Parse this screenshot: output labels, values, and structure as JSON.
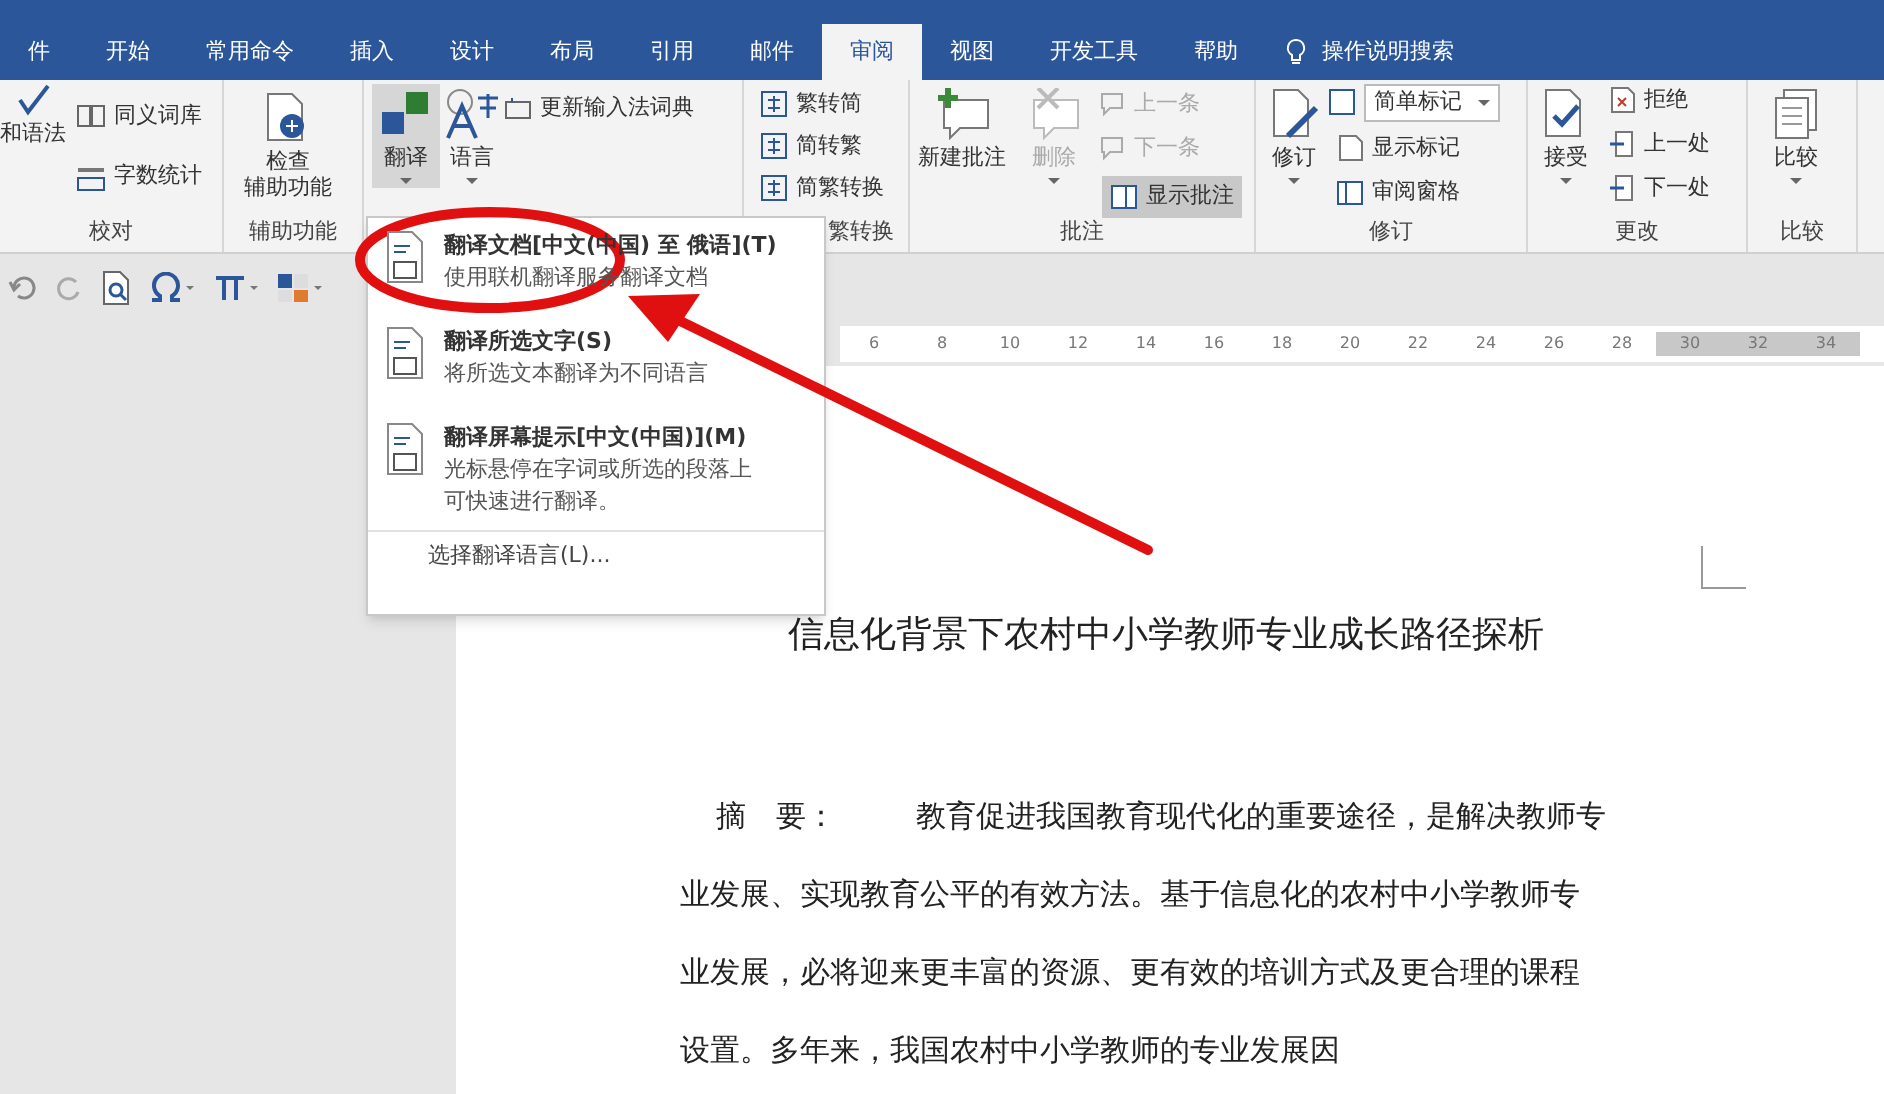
{
  "tabs": [
    {
      "label": "件",
      "selected": false
    },
    {
      "label": "开始",
      "selected": false
    },
    {
      "label": "常用命令",
      "selected": false
    },
    {
      "label": "插入",
      "selected": false
    },
    {
      "label": "设计",
      "selected": false
    },
    {
      "label": "布局",
      "selected": false
    },
    {
      "label": "引用",
      "selected": false
    },
    {
      "label": "邮件",
      "selected": false
    },
    {
      "label": "审阅",
      "selected": true
    },
    {
      "label": "视图",
      "selected": false
    },
    {
      "label": "开发工具",
      "selected": false
    },
    {
      "label": "帮助",
      "selected": false
    }
  ],
  "tell_me": "操作说明搜索",
  "ribbon": {
    "proofing": {
      "spelling": "和语法",
      "thesaurus": "同义词库",
      "word_count": "字数统计",
      "label": "校对"
    },
    "accessibility": {
      "check": [
        "检查",
        "辅助功能"
      ],
      "label": "辅助功能"
    },
    "language": {
      "translate": "翻译",
      "language": "语言",
      "update_ime": "更新输入法词典"
    },
    "chinese_conversion": {
      "items": [
        "繁转简",
        "简转繁",
        "简繁转换"
      ],
      "label": "繁转换"
    },
    "comments": {
      "new": "新建批注",
      "delete": "删除",
      "delete_disabled": true,
      "previous": "上一条",
      "previous_disabled": true,
      "next": "下一条",
      "next_disabled": true,
      "show": "显示批注",
      "show_selected": true,
      "label": "批注"
    },
    "tracking": {
      "track": "修订",
      "markup": "简单标记",
      "show_markup": "显示标记",
      "reviewing_pane": "审阅窗格",
      "label": "修订"
    },
    "changes": {
      "accept": "接受",
      "reject": "拒绝",
      "previous": "上一处",
      "next": "下一处",
      "label": "更改"
    },
    "compare": {
      "compare": "比较",
      "label": "比较"
    }
  },
  "ruler": [
    "6",
    "8",
    "10",
    "12",
    "14",
    "16",
    "18",
    "20",
    "22",
    "24",
    "26",
    "28",
    "30",
    "32",
    "34"
  ],
  "translate_menu": {
    "items": [
      {
        "title": "翻译文档[中文(中国) 至 俄语](T)",
        "description": "使用联机翻译服务翻译文档"
      },
      {
        "title": "翻译所选文字(S)",
        "description": "将所选文本翻译为不同语言"
      },
      {
        "title": "翻译屏幕提示[中文(中国)](M)",
        "description": "光标悬停在字词或所选的段落上可快速进行翻译。"
      }
    ],
    "footer": "选择翻译语言(L)..."
  },
  "document": {
    "title": "信息化背景下农村中小学教师专业成长路径探析",
    "abstract_label": "摘　要：",
    "abstract_lines": [
      "教育促进我国教育现代化的重要途径，是解决教师专",
      "业发展、实现教育公平的有效方法。基于信息化的农村中小学教师专",
      "业发展，必将迎来更丰富的资源、更有效的培训方式及更合理的课程",
      "设置。多年来，我国农村中小学教师的专业发展因"
    ]
  }
}
